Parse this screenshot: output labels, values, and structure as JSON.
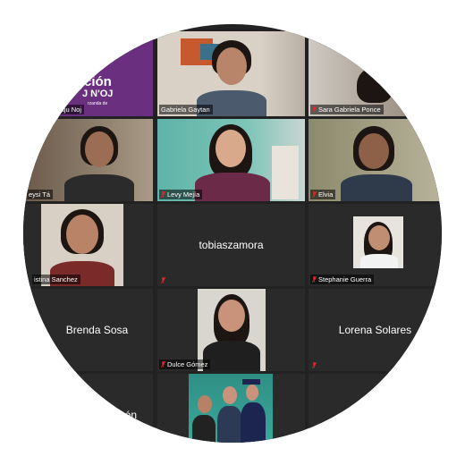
{
  "colors": {
    "grid_bg": "#222222",
    "tile_bg": "#2a2a2a",
    "active_border": "#c6e27a",
    "mic_muted": "#e02828",
    "label_text": "#ffffff"
  },
  "tiles": {
    "t1": {
      "name": "jaju Noj",
      "logo_line1": "ción",
      "logo_line2": "J N'OJ",
      "logo_line3": "rzanda de"
    },
    "t2": {
      "name": "Gabriela Gaytan"
    },
    "t3": {
      "name": "Sara Gabriela Ponce"
    },
    "t4": {
      "name": "eysi Tá"
    },
    "t5": {
      "name": "Levy Mejía"
    },
    "t6": {
      "name": "Elvia"
    },
    "t7": {
      "name": "istina Sanchez"
    },
    "t8": {
      "name": "tobiaszamora"
    },
    "t9": {
      "name": "Stephanie Guerra"
    },
    "t10": {
      "name": "Brenda Sosa"
    },
    "t11": {
      "name": "Dulce Gómez"
    },
    "t12": {
      "name": "Lorena Solares"
    },
    "t13": {
      "name": "ón"
    }
  }
}
